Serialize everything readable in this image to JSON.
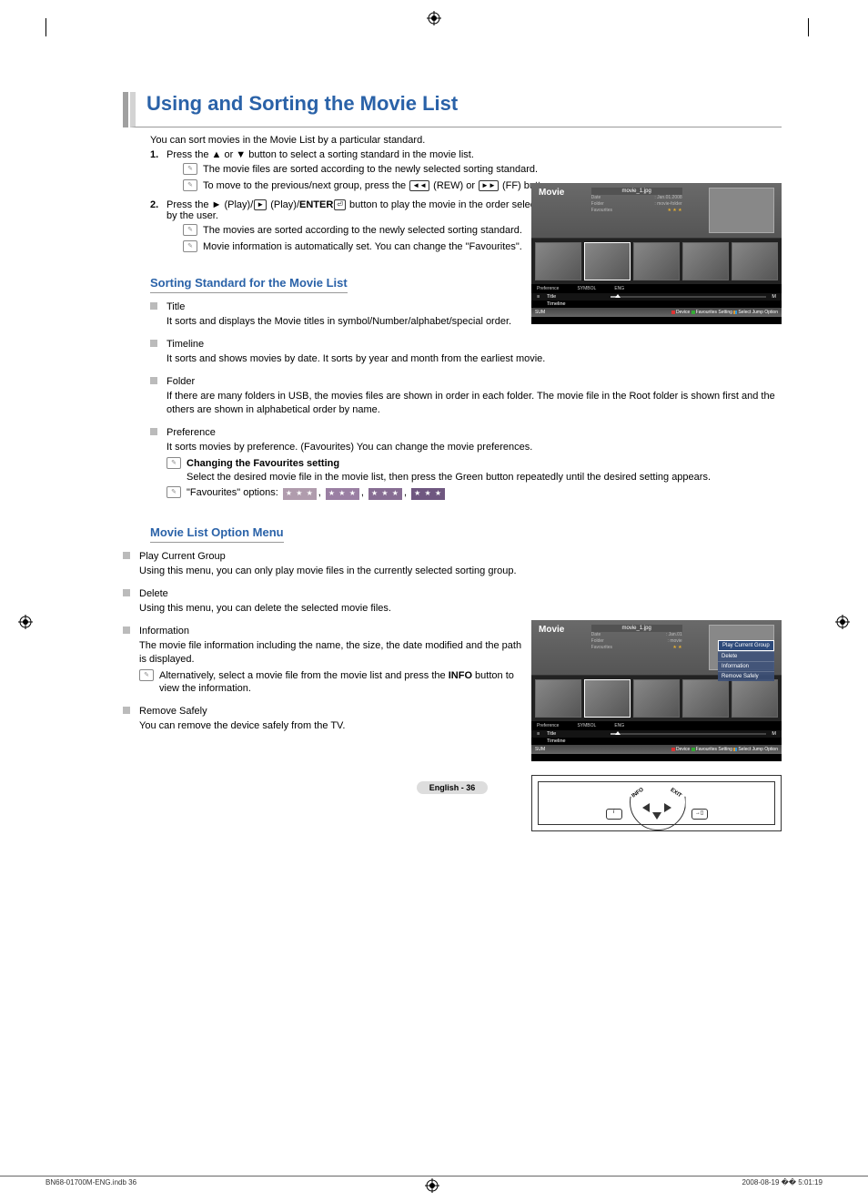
{
  "title": "Using and Sorting the Movie List",
  "intro": "You can sort movies in the Movie List by a particular standard.",
  "steps": [
    {
      "num": "1.",
      "text": "Press the ▲ or ▼ button to select a sorting standard in the movie list.",
      "notes": [
        "The movie files are sorted according to the newly selected sorting standard.",
        "To move to the previous/next group, press the ◄◄ (REW) or ►► (FF) button."
      ]
    },
    {
      "num": "2.",
      "text_pre": "Press the ► (Play)/",
      "text_bold": "ENTER",
      "text_post": " button to play the movie in the order selected by the user.",
      "notes": [
        "The movies are sorted according to the newly selected sorting standard.",
        "Movie information is automatically set. You can change the \"Favourites\"."
      ]
    }
  ],
  "section_sorting": {
    "heading": "Sorting Standard for the Movie List",
    "items": [
      {
        "title": "Title",
        "desc": "It sorts and displays the Movie titles in symbol/Number/alphabet/special order."
      },
      {
        "title": "Timeline",
        "desc": "It sorts and shows movies by date. It sorts by year and month from the earliest movie."
      },
      {
        "title": "Folder",
        "desc": "If there are many folders in USB, the movies files are shown in order in each folder. The movie file in the Root folder is shown first and the others are shown in alphabetical order by name."
      },
      {
        "title": "Preference",
        "desc": "It sorts movies by preference. (Favourites) You can change the movie preferences.",
        "subnotes": [
          {
            "bold": "Changing the Favourites setting",
            "text": "Select the desired movie file in the movie list, then press the Green button repeatedly until the desired setting appears."
          },
          {
            "favopts": true,
            "text": "\"Favourites\" options:"
          }
        ]
      }
    ]
  },
  "section_option": {
    "heading": "Movie List Option Menu",
    "items": [
      {
        "title": "Play Current Group",
        "desc": "Using this menu, you can only play movie files in the currently selected sorting group."
      },
      {
        "title": "Delete",
        "desc": "Using this menu, you can delete the selected movie files."
      },
      {
        "title": "Information",
        "desc": "The movie file information including the name, the size, the date modified and the path is displayed.",
        "subnotes": [
          {
            "text_pre": "Alternatively, select a movie file from the movie list and press the ",
            "text_bold": "INFO",
            "text_post": " button to view the information."
          }
        ]
      },
      {
        "title": "Remove Safely",
        "desc": "You can remove the device safely from the TV."
      }
    ]
  },
  "tv1": {
    "title": "Movie",
    "filename": "movie_1.jpg",
    "meta": {
      "date_l": "Date",
      "date_v": ": Jan.01.2008",
      "folder_l": "Folder",
      "folder_v": ": movie-folder",
      "fav_l": "Favourites",
      "fav_v": "★ ★ ★"
    },
    "sort": {
      "pref": "Preference",
      "symbol": "SYMBOL",
      "eng": "ENG",
      "title": "Title",
      "timeline": "Timeline",
      "m": "M"
    },
    "footer": {
      "sum": "SUM",
      "device": "Device",
      "fav": "Favourites Setting",
      "select": "Select",
      "jump": "Jump",
      "option": "Option"
    }
  },
  "tv2": {
    "title": "Movie",
    "filename": "movie_1.jpg",
    "menu": [
      "Play Current Group",
      "Delete",
      "Information",
      "Remove Safely"
    ],
    "footer": {
      "sum": "SUM",
      "device": "Device",
      "fav": "Favourites Setting",
      "select": "Select",
      "jump": "Jump",
      "option": "Option"
    }
  },
  "remote": {
    "info": "INFO",
    "exit": "EXIT",
    "q": "❓",
    "x": "✕"
  },
  "pagenum": "English - 36",
  "footer": {
    "left": "BN68-01700M-ENG.indb   36",
    "right": "2008-08-19   �� 5:01:19"
  }
}
